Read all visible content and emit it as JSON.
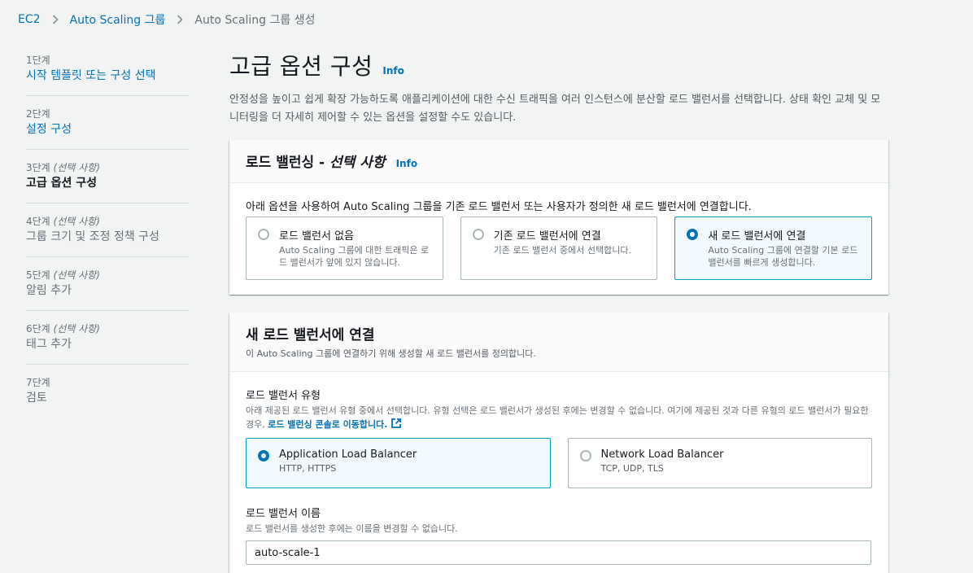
{
  "breadcrumb": {
    "items": [
      "EC2",
      "Auto Scaling 그룹",
      "Auto Scaling 그룹 생성"
    ]
  },
  "steps": [
    {
      "num": "1단계",
      "optional": "",
      "title": "시작 템플릿 또는 구성 선택",
      "state": "link"
    },
    {
      "num": "2단계",
      "optional": "",
      "title": "설정 구성",
      "state": "link"
    },
    {
      "num": "3단계",
      "optional": "(선택 사항)",
      "title": "고급 옵션 구성",
      "state": "current"
    },
    {
      "num": "4단계",
      "optional": "(선택 사항)",
      "title": "그룹 크기 및 조정 정책 구성",
      "state": "disabled"
    },
    {
      "num": "5단계",
      "optional": "(선택 사항)",
      "title": "알림 추가",
      "state": "disabled"
    },
    {
      "num": "6단계",
      "optional": "(선택 사항)",
      "title": "태그 추가",
      "state": "disabled"
    },
    {
      "num": "7단계",
      "optional": "",
      "title": "검토",
      "state": "disabled"
    }
  ],
  "page": {
    "title": "고급 옵션 구성",
    "info": "Info",
    "description": "안정성을 높이고 쉽게 확장 가능하도록 애플리케이션에 대한 수신 트래픽을 여러 인스턴스에 분산할 로드 밸런서를 선택합니다. 상태 확인 교체 및 모니터링을 더 자세히 제어할 수 있는 옵션을 설정할 수도 있습니다."
  },
  "load_balancing": {
    "title": "로드 밸런싱 - ",
    "title_optional": "선택 사항",
    "info": "Info",
    "lead": "아래 옵션을 사용하여 Auto Scaling 그룹을 기존 로드 밸런서 또는 사용자가 정의한 새 로드 밸런서에 연결합니다.",
    "options": [
      {
        "title": "로드 밸런서 없음",
        "desc": "Auto Scaling 그룹에 대한 트래픽은 로드 밸런서가 앞에 있지 않습니다."
      },
      {
        "title": "기존 로드 밸런서에 연결",
        "desc": "기존 로드 밸런서 중에서 선택합니다."
      },
      {
        "title": "새 로드 밸런서에 연결",
        "desc": "Auto Scaling 그룹에 연결할 기본 로드 밸런서를 빠르게 생성합니다."
      }
    ],
    "selected_index": 2
  },
  "new_lb": {
    "title": "새 로드 밸런서에 연결",
    "subtitle": "이 Auto Scaling 그룹에 연결하기 위해 생성할 새 로드 밸런서를 정의합니다.",
    "type_label": "로드 밸런서 유형",
    "type_desc": "아래 제공된 로드 밸런서 유형 중에서 선택합니다. 유형 선택은 로드 밸런서가 생성된 후에는 변경할 수 없습니다. 여기에 제공된 것과 다른 유형의 로드 밸런서가 필요한 경우, ",
    "type_link": "로드 밸런싱 콘솔로 이동합니다.",
    "types": [
      {
        "title": "Application Load Balancer",
        "desc": "HTTP, HTTPS"
      },
      {
        "title": "Network Load Balancer",
        "desc": "TCP, UDP, TLS"
      }
    ],
    "type_selected_index": 0,
    "name_label": "로드 밸런서 이름",
    "name_desc": "로드 밸런서를 생성한 후에는 이름을 변경할 수 없습니다.",
    "name_value": "auto-scale-1"
  }
}
